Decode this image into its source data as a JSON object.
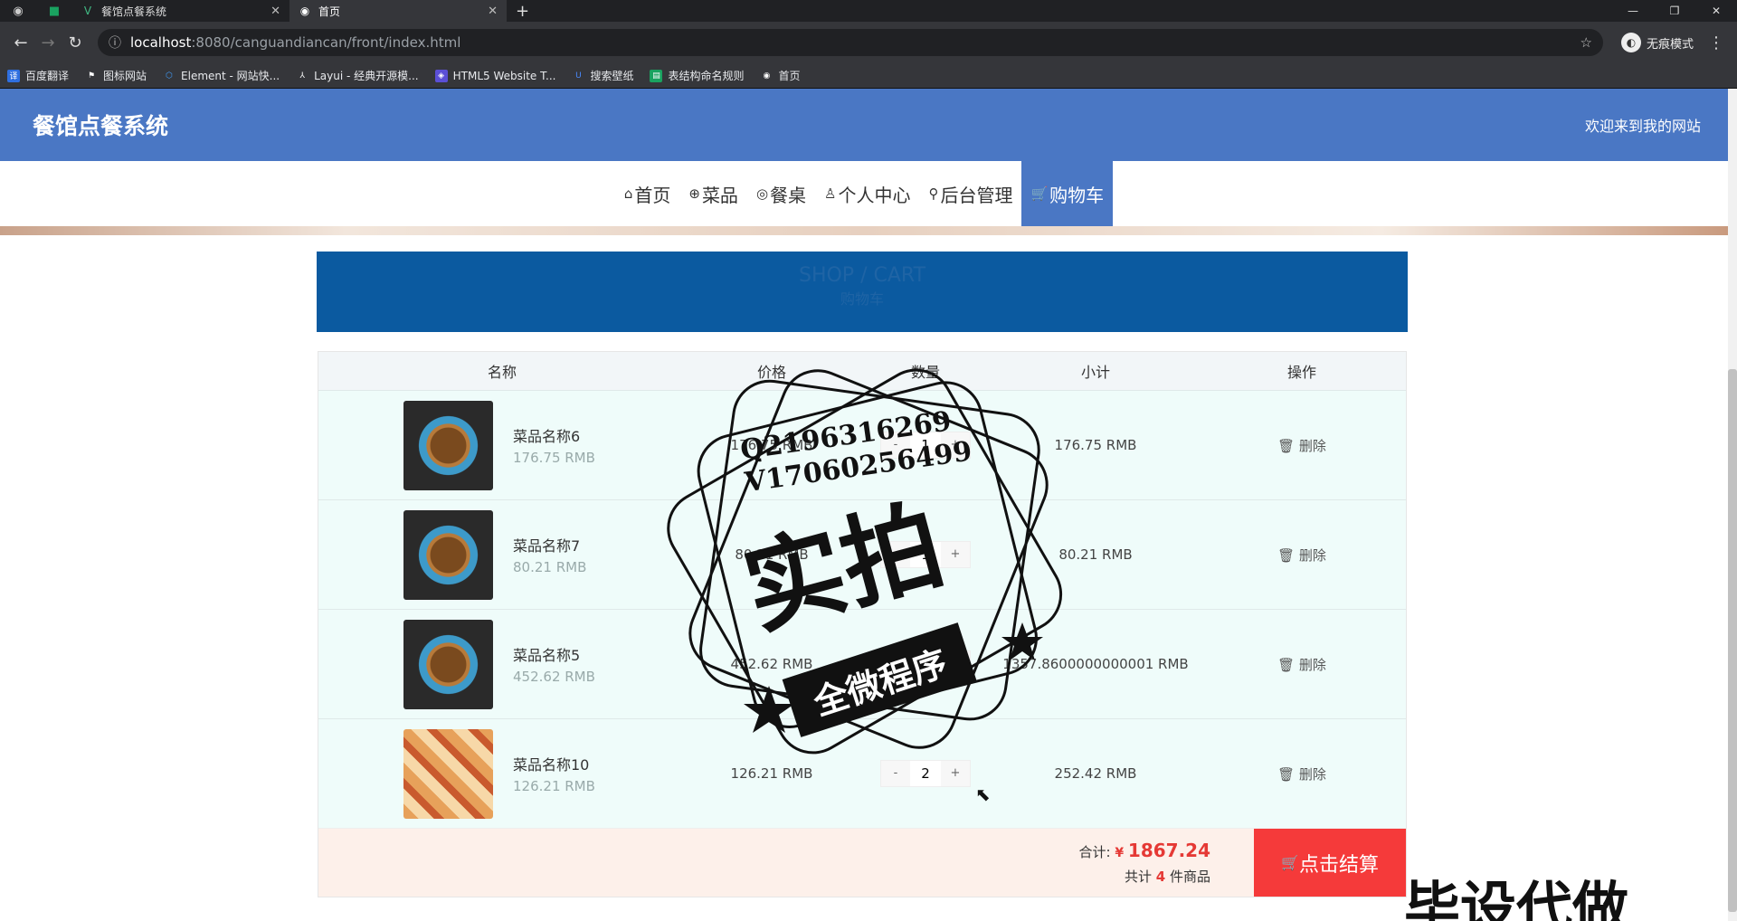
{
  "browser": {
    "tabs": [
      {
        "title": "餐馆点餐系统",
        "active": false
      },
      {
        "title": "首页",
        "active": true
      }
    ],
    "url_host": "localhost",
    "url_path": ":8080/canguandiancan/front/index.html",
    "incognito_label": "无痕模式",
    "bookmarks": [
      "百度翻译",
      "图标网站",
      "Element - 网站快...",
      "Layui - 经典开源模...",
      "HTML5 Website T...",
      "搜索壁纸",
      "表结构命名规则",
      "首页"
    ]
  },
  "site": {
    "logo": "餐馆点餐系统",
    "welcome": "欢迎来到我的网站",
    "menu": [
      {
        "label": "首页",
        "icon": "⌂"
      },
      {
        "label": "菜品",
        "icon": "⊕"
      },
      {
        "label": "餐桌",
        "icon": "◎"
      },
      {
        "label": "个人中心",
        "icon": "♙"
      },
      {
        "label": "后台管理",
        "icon": "⚲"
      },
      {
        "label": "购物车",
        "icon": "🛒"
      }
    ],
    "active_menu": "购物车"
  },
  "banner": {
    "en": "SHOP / CART",
    "cn": "购物车"
  },
  "cart": {
    "headers": [
      "名称",
      "价格",
      "数量",
      "小计",
      "操作"
    ],
    "items": [
      {
        "name": "菜品名称6",
        "price": "176.75 RMB",
        "price_sub": "176.75 RMB",
        "qty": "1",
        "subtotal": "176.75 RMB",
        "op": "删除",
        "img": "bowl"
      },
      {
        "name": "菜品名称7",
        "price": "80.21 RMB",
        "price_sub": "80.21 RMB",
        "qty": "1",
        "subtotal": "80.21 RMB",
        "op": "删除",
        "img": "bowl"
      },
      {
        "name": "菜品名称5",
        "price": "452.62 RMB",
        "price_sub": "452.62 RMB",
        "qty": "3",
        "subtotal": "1357.8600000000001 RMB",
        "op": "删除",
        "img": "bowl"
      },
      {
        "name": "菜品名称10",
        "price": "126.21 RMB",
        "price_sub": "126.21 RMB",
        "qty": "2",
        "subtotal": "252.42 RMB",
        "op": "删除",
        "img": "box"
      }
    ],
    "total_label": "合计:",
    "currency": "¥",
    "total": "1867.24",
    "count_prefix": "共计",
    "count": "4",
    "count_suffix": "件商品",
    "checkout_label": "点击结算"
  },
  "watermark": {
    "line1": "Q2196316269",
    "line2": "V17060256499",
    "big": "实拍",
    "band": "全微程序",
    "bottom": "毕设代做"
  },
  "colors": {
    "primary": "#4a77c4",
    "banner": "#0b5aa0",
    "checkout": "#f53a3a",
    "row_bg": "#effcfa"
  }
}
